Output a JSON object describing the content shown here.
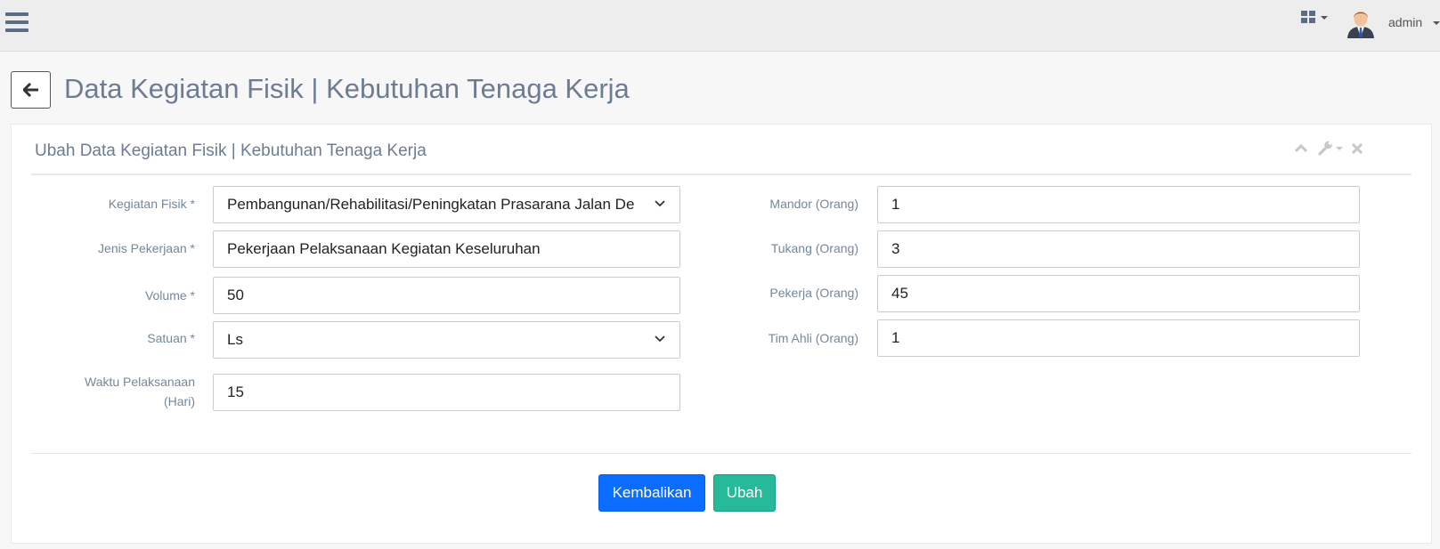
{
  "header": {
    "menu_icon": "hamburger-menu-icon",
    "apps_icon": "grid-icon",
    "user": {
      "name": "admin",
      "avatar_icon": "user-avatar"
    }
  },
  "page": {
    "back_icon": "arrow-left-icon",
    "title": "Data Kegiatan Fisik | Kebutuhan Tenaga Kerja"
  },
  "panel": {
    "title": "Ubah Data Kegiatan Fisik | Kebutuhan Tenaga Kerja",
    "tools": [
      "chevron-up-icon",
      "wrench-icon",
      "close-icon"
    ]
  },
  "form": {
    "kegiatan_fisik": {
      "label": "Kegiatan Fisik *",
      "value": "Pembangunan/Rehabilitasi/Peningkatan Prasarana Jalan De"
    },
    "jenis_pekerjaan": {
      "label": "Jenis Pekerjaan *",
      "value": "Pekerjaan Pelaksanaan Kegiatan Keseluruhan"
    },
    "volume": {
      "label": "Volume *",
      "value": "50"
    },
    "satuan": {
      "label": "Satuan *",
      "value": "Ls"
    },
    "waktu": {
      "label_line1": "Waktu Pelaksanaan",
      "label_line2": "(Hari)",
      "value": "15"
    },
    "mandor": {
      "label": "Mandor (Orang)",
      "value": "1"
    },
    "tukang": {
      "label": "Tukang (Orang)",
      "value": "3"
    },
    "pekerja": {
      "label": "Pekerja (Orang)",
      "value": "45"
    },
    "tim_ahli": {
      "label": "Tim Ahli (Orang)",
      "value": "1"
    }
  },
  "buttons": {
    "reset": "Kembalikan",
    "submit": "Ubah"
  },
  "colors": {
    "primary": "#0a6dff",
    "success": "#26b99a",
    "title": "#6d7c93",
    "label": "#73879c",
    "topbar": "#ededed"
  }
}
